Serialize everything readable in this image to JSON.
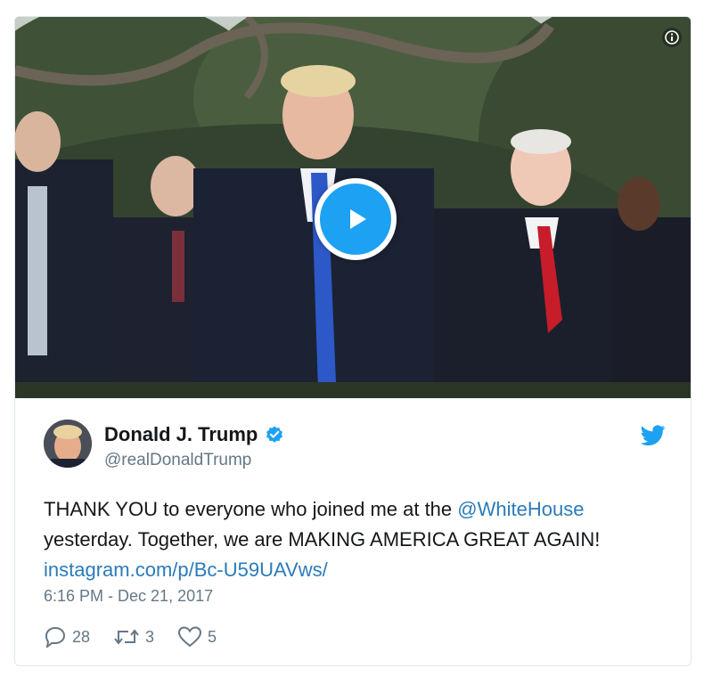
{
  "video": {
    "info_icon": "info-icon",
    "play_icon": "play-icon"
  },
  "author": {
    "name": "Donald J. Trump",
    "handle": "@realDonaldTrump",
    "verified_icon": "verified-badge-icon"
  },
  "tweet": {
    "text_part1": "THANK YOU to everyone who joined me at the ",
    "mention": "@WhiteHouse",
    "text_part2": "yesterday. Together, we are MAKING AMERICA GREAT AGAIN!",
    "link": "instagram.com/p/Bc-U59UAVws/",
    "timestamp": "6:16 PM - Dec 21, 2017"
  },
  "actions": {
    "replies": "28",
    "retweets": "3",
    "likes": "5"
  },
  "colors": {
    "accent": "#1da1f2",
    "link": "#2b7bb9",
    "muted": "#657786"
  }
}
